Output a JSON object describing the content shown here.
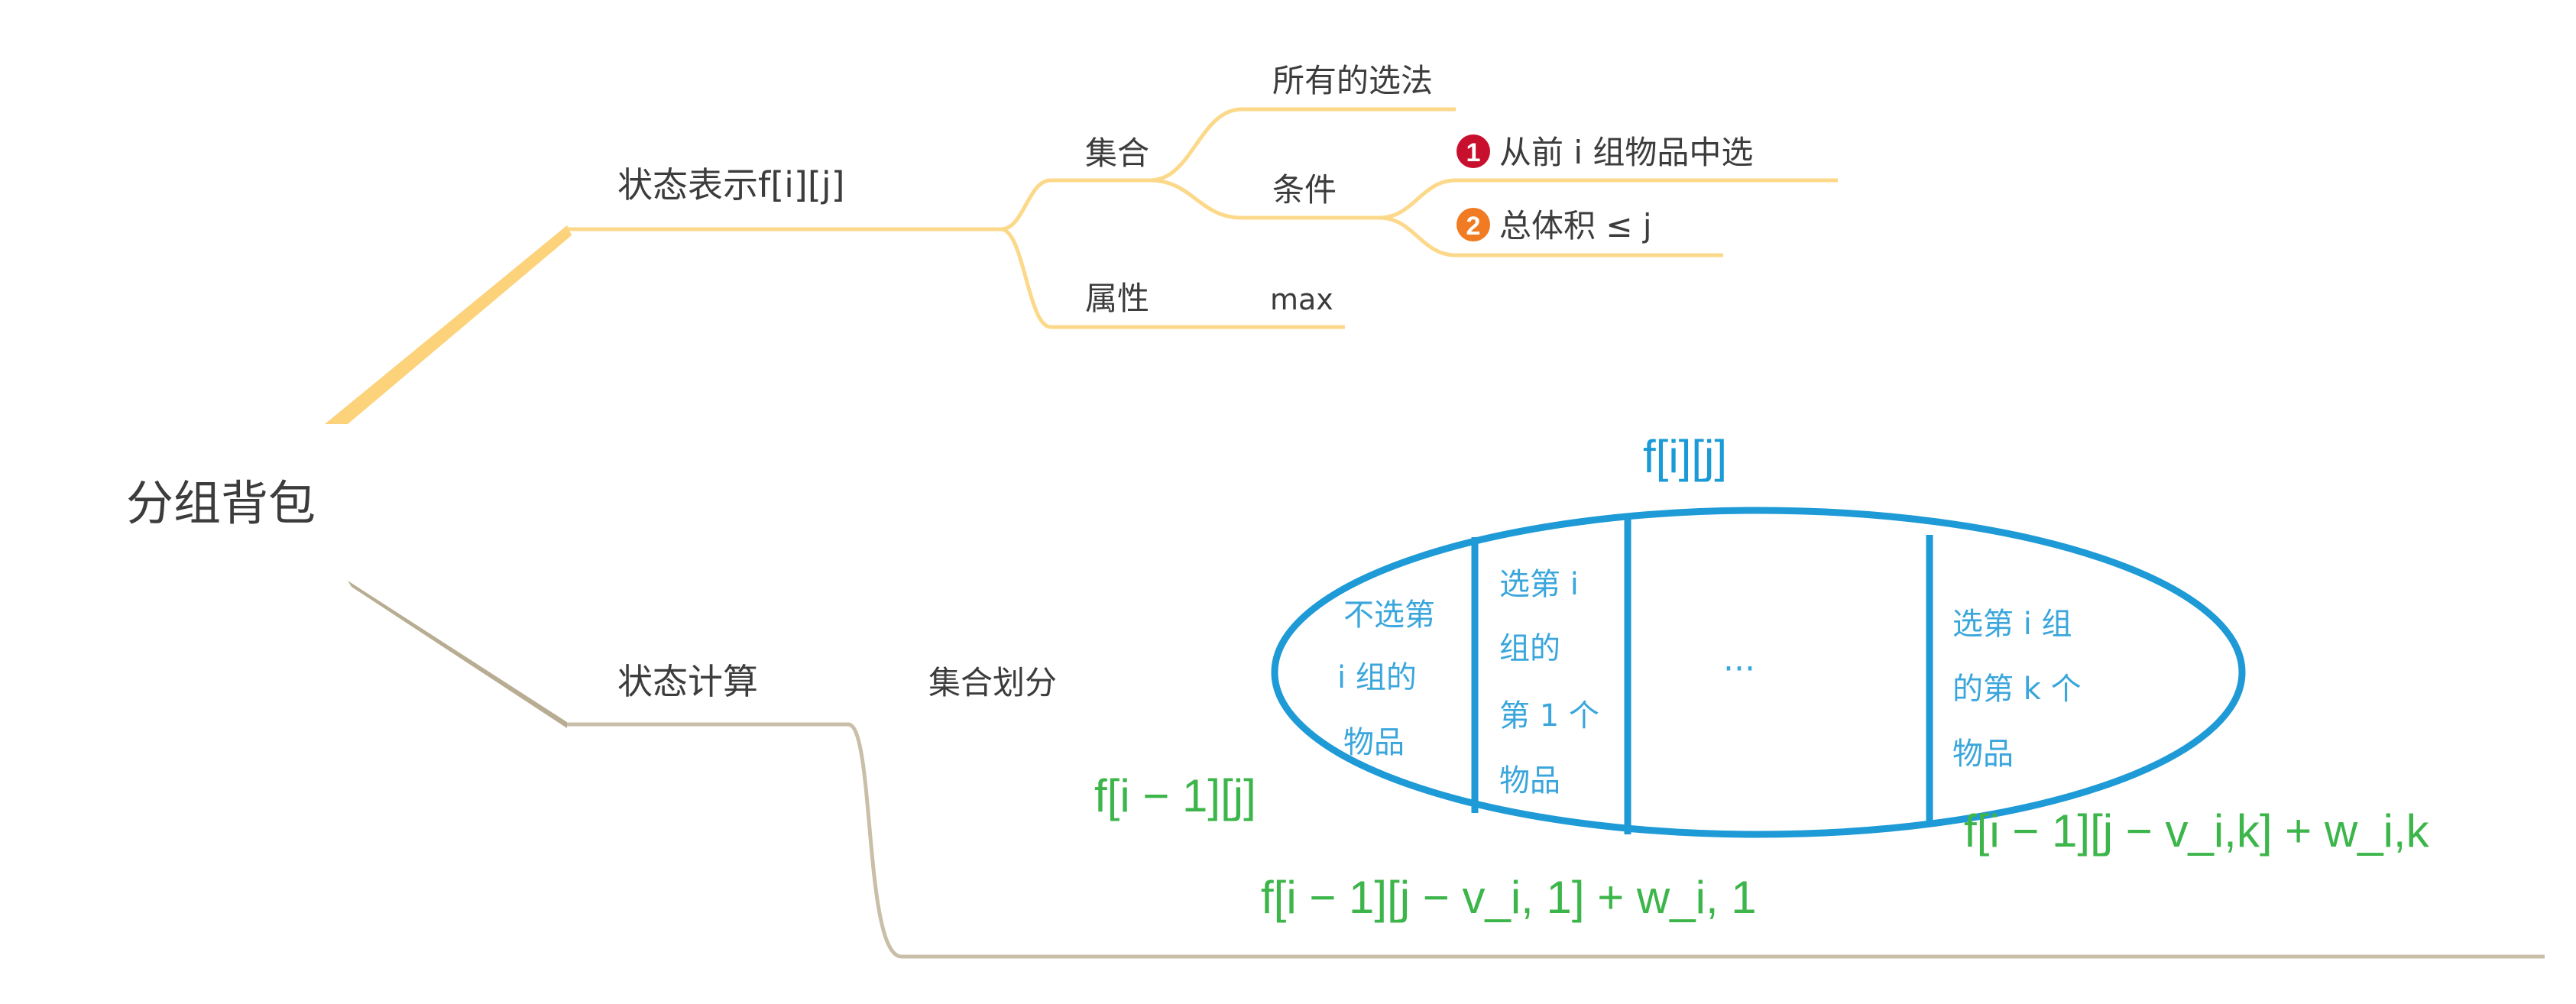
{
  "root": {
    "label": "分组背包"
  },
  "state_repr": {
    "label": "状态表示f[i][j]",
    "set": {
      "label": "集合",
      "all_choices": "所有的选法",
      "condition": {
        "label": "条件",
        "items": [
          {
            "num": "1",
            "text": "从前 i 组物品中选",
            "badge_color": "#c8102e"
          },
          {
            "num": "2",
            "text": "总体积 ≤ j",
            "badge_color": "#f07b22"
          }
        ]
      }
    },
    "attribute": {
      "label": "属性",
      "value": "max"
    }
  },
  "state_calc": {
    "label": "状态计算",
    "partition_label": "集合划分",
    "diagram": {
      "top_label": "f[i][j]",
      "sections": [
        {
          "lines": [
            "不选第",
            "i 组的",
            "物品"
          ]
        },
        {
          "lines": [
            "选第 i",
            "组的",
            "第 1 个",
            "物品"
          ]
        },
        {
          "lines": [
            "···"
          ]
        },
        {
          "lines": [
            "选第 i 组",
            "的第 k 个",
            "物品"
          ]
        }
      ],
      "formulas": {
        "left": "f[i − 1][j]",
        "bottom": "f[i − 1][j − v_i, 1] + w_i, 1",
        "right": "f[i − 1][j − v_i,k] + w_i,k"
      }
    }
  },
  "colors": {
    "upper_branch": "#fcd98a",
    "upper_trunk": "#fcd27a",
    "lower_branch": "#c9bfa8",
    "lower_trunk": "#b8ad92",
    "ellipse": "#1e9ad6",
    "handwriting": "#3aa6dc",
    "formula": "#3cb54a"
  }
}
